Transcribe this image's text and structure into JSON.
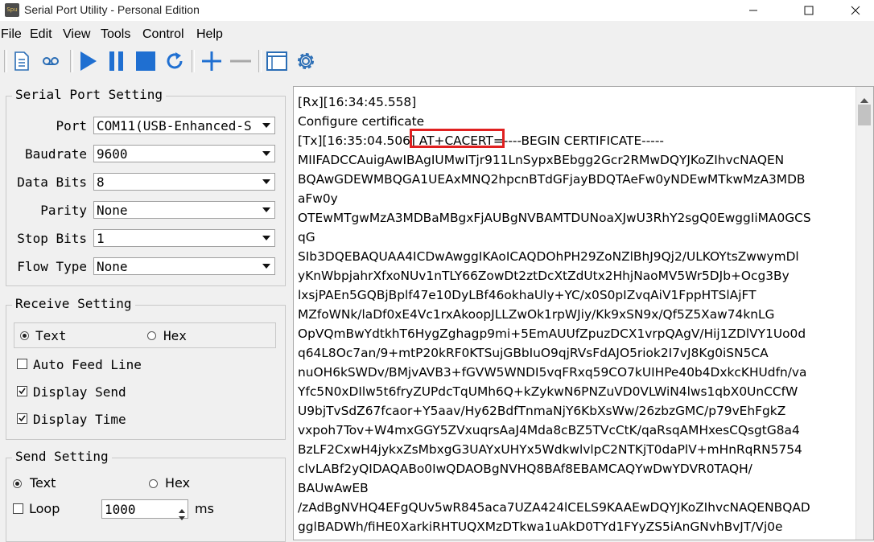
{
  "window": {
    "title": "Serial Port Utility - Personal Edition",
    "icon_text": "Spu"
  },
  "menu": {
    "items": [
      "File",
      "Edit",
      "View",
      "Tools",
      "Control",
      "Help"
    ]
  },
  "toolbar": {
    "icons": [
      "document-icon",
      "cassette-icon",
      "play-icon",
      "pause-icon",
      "stop-icon",
      "refresh-icon",
      "add-icon",
      "remove-icon",
      "window-icon",
      "settings-gear-icon"
    ]
  },
  "serial": {
    "title": "Serial Port Setting",
    "port_label": "Port",
    "port_value": "COM11(USB-Enhanced-S",
    "baud_label": "Baudrate",
    "baud_value": "9600",
    "databits_label": "Data Bits",
    "databits_value": "8",
    "parity_label": "Parity",
    "parity_value": "None",
    "stopbits_label": "Stop Bits",
    "stopbits_value": "1",
    "flow_label": "Flow Type",
    "flow_value": "None"
  },
  "receive": {
    "title": "Receive Setting",
    "text_label": "Text",
    "hex_label": "Hex",
    "selected": "Text",
    "auto_feed_label": "Auto Feed Line",
    "auto_feed": false,
    "display_send_label": "Display Send",
    "display_send": true,
    "display_time_label": "Display Time",
    "display_time": true
  },
  "send": {
    "title": "Send Setting",
    "text_label": "Text",
    "hex_label": "Hex",
    "selected": "Text",
    "loop_label": "Loop",
    "loop": false,
    "interval_value": "1000",
    "interval_unit": "ms"
  },
  "output": {
    "lines": [
      "[Rx][16:34:45.558]",
      "Configure certificate",
      "[Tx][16:35:04.506] AT+CACERT=----BEGIN CERTIFICATE-----",
      "MIIFADCCAuigAwIBAgIUMwITjr911LnSypxBEbgg2Gcr2RMwDQYJKoZIhvcNAQEN",
      "BQAwGDEWMBQGA1UEAxMNQ2hpcnBTdGFjayBDQTAeFw0yNDEwMTkwMzA3MDB",
      "aFw0y",
      "OTEwMTgwMzA3MDBaMBgxFjAUBgNVBAMTDUNoaXJwU3RhY2sgQ0EwggIiMA0GCS",
      "qG",
      "SIb3DQEBAQUAA4ICDwAwggIKAoICAQDOhPH29ZoNZlBhJ9Qj2/ULKOYtsZwwymDl",
      "yKnWbpjahrXfxoNUv1nTLY66ZowDt2ztDcXtZdUtx2HhjNaoMV5Wr5DJb+Ocg3By",
      "lxsjPAEn5GQBjBplf47e10DyLBf46okhaUly+YC/x0S0pIZvqAiV1FppHTSlAjFT",
      "MZfoWNk/laDf0xE4Vc1rxAkoopJLLZwOk1rpWJiy/Kk9xSN9x/Qf5Z5Xaw74knLG",
      "OpVQmBwYdtkhT6HygZghagp9mi+5EmAUUfZpuzDCX1vrpQAgV/Hij1ZDlVY1Uo0d",
      "q64L8Oc7an/9+mtP20kRF0KTSujGBbIuO9qjRVsFdAJO5riok2I7vJ8Kg0iSN5CA",
      "nuOH6kSWDv/BMjvAVB3+fGVW5WNDI5vqFRxq59CO7kUIHPe40b4DxkcKHUdfn/va",
      "Yfc5N0xDIlw5t6fryZUPdcTqUMh6Q+kZykwN6PNZuVD0VLWiN4lws1qbX0UnCCfW",
      "U9bjTvSdZ67fcaor+Y5aav/Hy62BdfTnmaNjY6KbXsWw/26zbzGMC/p79vEhFgkZ",
      "vxpoh7Tov+W4mxGGY5ZVxuqrsAaJ4Mda8cBZ5TVcCtK/qaRsqAMHxesCQsgtG8a4",
      "BzLF2CxwH4jykxZsMbxgG3UAYxUHYx5WdkwlvlpC2NTKjT0daPlV+mHnRqRN5754",
      "clvLABf2yQIDAQABo0IwQDAOBgNVHQ8BAf8EBAMCAQYwDwYDVR0TAQH/",
      "BAUwAwEB",
      "/zAdBgNVHQ4EFgQUv5wR845aca7UZA424lCELS9KAAEwDQYJKoZIhvcNAQENBQAD",
      "gglBADWh/fiHE0XarkiRHTUQXMzDTkwa1uAkD0TYd1FYyZS5iAnGNvhBvJT/Vj0e"
    ]
  },
  "colors": {
    "highlight": "#e02020",
    "accent": "#1f6fd1"
  }
}
